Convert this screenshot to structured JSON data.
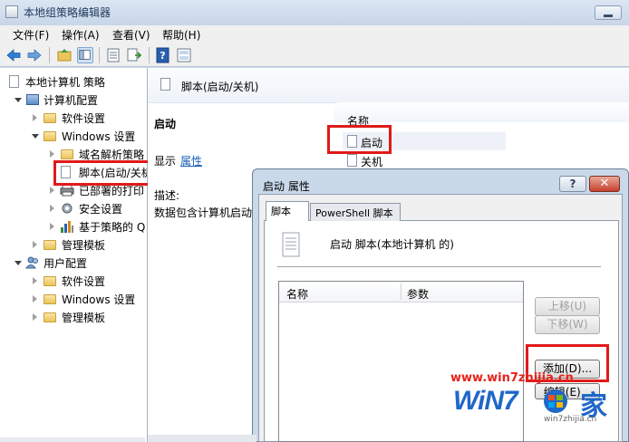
{
  "window": {
    "title": "本地组策略编辑器"
  },
  "menu": [
    "文件(F)",
    "操作(A)",
    "查看(V)",
    "帮助(H)"
  ],
  "tree": {
    "root": "本地计算机 策略",
    "computer_config": "计算机配置",
    "software_settings": "软件设置",
    "windows_settings": "Windows 设置",
    "dns_policy": "域名解析策略",
    "scripts": "脚本(启动/关机)",
    "deployed_printers": "已部署的打印",
    "security_settings": "安全设置",
    "policy_qos": "基于策略的 Q",
    "admin_templates": "管理模板",
    "user_config": "用户配置",
    "user_software_settings": "软件设置",
    "user_windows_settings": "Windows 设置",
    "user_admin_templates": "管理模板"
  },
  "right": {
    "header_title": "脚本(启动/关机)",
    "section_title": "启动",
    "show_label": "显示",
    "properties_link": "属性",
    "description_label": "描述:",
    "description_text": "数据包含计算机启动",
    "column_name": "名称",
    "items": [
      "启动",
      "关机"
    ]
  },
  "dialog": {
    "title": "启动 属性",
    "help": "?",
    "close": "✕",
    "tabs": [
      "脚本",
      "PowerShell 脚本"
    ],
    "heading": "启动 脚本(本地计算机 的)",
    "columns": [
      "名称",
      "参数"
    ],
    "buttons": {
      "up": "上移(U)",
      "down": "下移(W)",
      "add": "添加(D)...",
      "edit": "编辑(E)..."
    }
  },
  "watermark": {
    "url": "www.win7zhijia.cn",
    "logo": "WiN7",
    "jia": "家",
    "sub": "win7zhijia.cn"
  },
  "colors": {
    "highlight_box": "#e01a1a",
    "link": "#1a5fb4"
  }
}
